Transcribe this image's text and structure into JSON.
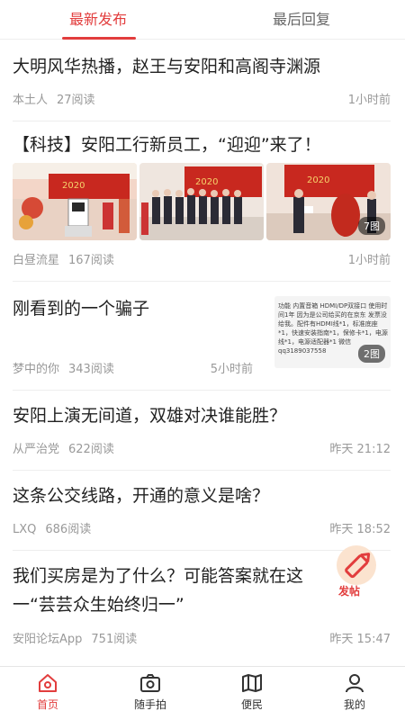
{
  "tabs": [
    {
      "label": "最新发布",
      "active": true
    },
    {
      "label": "最后回复",
      "active": false
    }
  ],
  "posts": [
    {
      "title": "大明风华热播，赵王与安阳和高阁寺渊源",
      "author": "本土人",
      "reads": "27阅读",
      "time": "1小时前"
    },
    {
      "title": "【科技】安阳工行新员工，“迎迎”来了！",
      "author": "白昼流星",
      "reads": "167阅读",
      "time": "1小时前",
      "photo_count": "7图"
    },
    {
      "title": "刚看到的一个骗子",
      "author": "梦中的你",
      "reads": "343阅读",
      "time": "5小时前",
      "photo_count": "2图",
      "thumb_text": "功能 内置音箱 HDMI/DP双接口 使用时间1年 因为是公司给买的在京东 发票没给我。配件有HDMI线*1，标准底座*1，快速安装指南*1，保修卡*1，电源线*1，电源适配器*1 微信qq3189037558"
    },
    {
      "title": "安阳上演无间道，双雄对决谁能胜？",
      "author": "从严治党",
      "reads": "622阅读",
      "time": "昨天 21:12"
    },
    {
      "title": "这条公交线路，开通的意义是啥？",
      "author": "LXQ",
      "reads": "686阅读",
      "time": "昨天 18:52"
    },
    {
      "title": "我们买房是为了什么？可能答案就在这",
      "title_line2": "一“芸芸众生始终归一”",
      "author": "安阳论坛App",
      "reads": "751阅读",
      "time": "昨天 15:47"
    }
  ],
  "fab": {
    "label": "发帖",
    "icon": "pencil-icon"
  },
  "bottom_nav": [
    {
      "label": "首页",
      "icon": "home-icon",
      "active": true
    },
    {
      "label": "随手拍",
      "icon": "camera-icon",
      "active": false
    },
    {
      "label": "便民",
      "icon": "map-icon",
      "active": false
    },
    {
      "label": "我的",
      "icon": "user-icon",
      "active": false
    }
  ],
  "colors": {
    "accent": "#e23d3d",
    "meta_text": "#999999",
    "divider": "#eeeeee"
  }
}
